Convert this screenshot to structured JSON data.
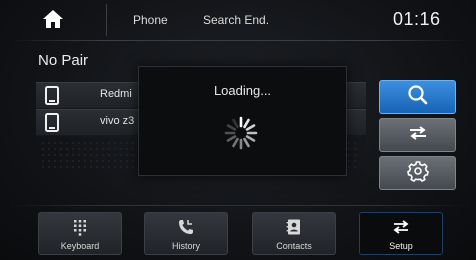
{
  "top_bar": {
    "home_icon": "home-icon",
    "tab_phone": "Phone",
    "status": "Search End.",
    "time": "01:16"
  },
  "device_list": {
    "title": "No Pair",
    "devices": [
      {
        "name": "Redmi",
        "icon": "phone-icon"
      },
      {
        "name": "vivo z3",
        "icon": "phone-icon"
      }
    ]
  },
  "loading_dialog": {
    "text": "Loading...",
    "icon": "spinner-icon"
  },
  "side_buttons": [
    {
      "icon": "search-icon",
      "active": true
    },
    {
      "icon": "swap-icon",
      "active": false
    },
    {
      "icon": "gear-icon",
      "active": false
    }
  ],
  "bottom_nav": [
    {
      "label": "Keyboard",
      "icon": "keypad-icon"
    },
    {
      "label": "History",
      "icon": "call-history-icon"
    },
    {
      "label": "Contacts",
      "icon": "contacts-icon"
    },
    {
      "label": "Setup",
      "icon": "swap-icon",
      "selected": true
    }
  ],
  "colors": {
    "accent_blue": "#1f74cf",
    "background": "#121418",
    "button_grey": "#55595f"
  }
}
